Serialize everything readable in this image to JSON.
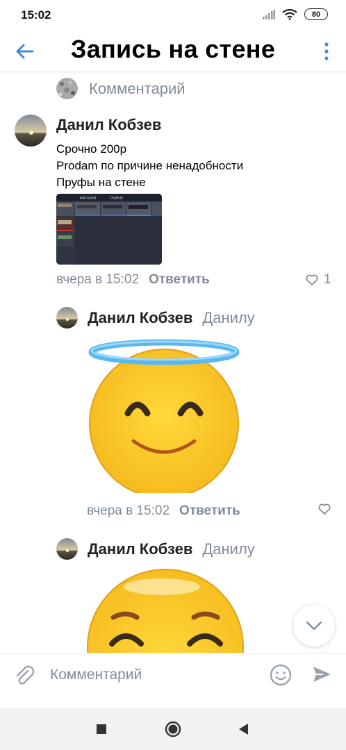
{
  "status_bar": {
    "time": "15:02",
    "battery": "80"
  },
  "header": {
    "title": "Запись на стене"
  },
  "previous_composer": {
    "placeholder": "Комментарий"
  },
  "comments": [
    {
      "author": "Данил Кобзев",
      "lines": [
        "Срочно 200р",
        "Prodam по причине ненадобности",
        "Пруфы на стене"
      ],
      "time": "вчера в 15:02",
      "reply_label": "Ответить",
      "likes": "1",
      "photo_tabs": [
        "МАГАЗИН",
        "РЫНОК"
      ]
    },
    {
      "author": "Данил Кобзев",
      "reply_to": "Данилу",
      "sticker": "angel-smile-emoji",
      "time": "вчера в 15:02",
      "reply_label": "Ответить"
    },
    {
      "author": "Данил Кобзев",
      "reply_to": "Данилу",
      "sticker": "smiling-face-emoji"
    }
  ],
  "composer": {
    "placeholder": "Комментарий"
  },
  "colors": {
    "accent": "#3f8ae0",
    "secondary_text": "#818c99",
    "emoji_yellow": "#fdc62e"
  }
}
